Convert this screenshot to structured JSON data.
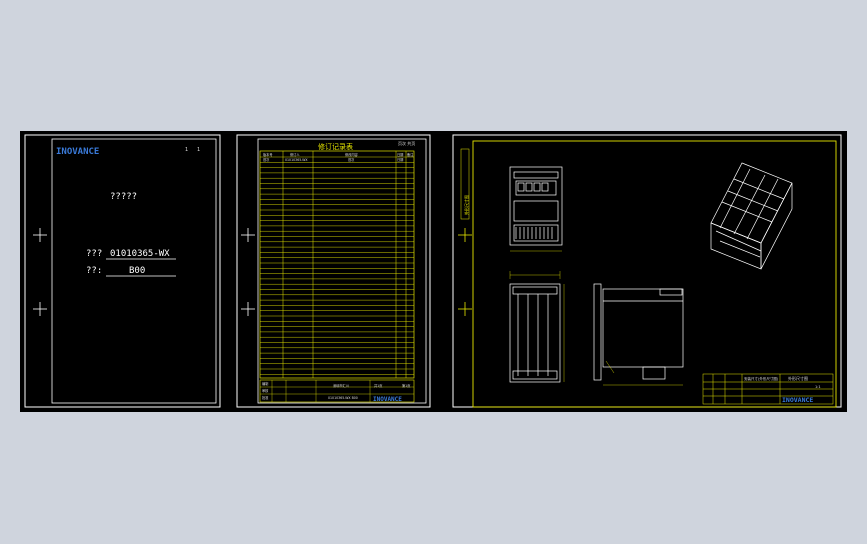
{
  "sheet1": {
    "logo": "INOVANCE",
    "page_no": "1",
    "page_total": "1",
    "title": "?????",
    "field1_label": "???",
    "field1_value": "01010365-WX",
    "field2_label": "??:",
    "field2_value": "B00"
  },
  "sheet2": {
    "title": "修订记录表",
    "header_right": "页次 共页",
    "col1": "版本号",
    "col2": "修订人",
    "col3": "修改内容",
    "col4": "日期",
    "col5": "备注",
    "row1_c1": "首次",
    "row1_c2": "01010365-WX",
    "row1_c3": "首次",
    "row1_c4": "日期",
    "footer_a": "编制",
    "footer_b": "审核",
    "footer_c": "批准",
    "footer_d": "深圳市汇川",
    "footer_e": "共1页",
    "footer_f": "第1页",
    "footer_g": "01010365-WX B00",
    "logo": "INOVANCE"
  },
  "sheet3": {
    "side_label": "外形尺寸图",
    "title_block_text": "安装尺寸(外形尺寸图)",
    "title_block_name": "外形尺寸图",
    "scale": "1:1",
    "logo": "INOVANCE"
  },
  "colors": {
    "canvas": "#000000",
    "background": "#cfd4dd",
    "sheet_border": "#ffffff",
    "yellow_frame": "#e6e600",
    "logo_blue": "#3a7ad9"
  }
}
